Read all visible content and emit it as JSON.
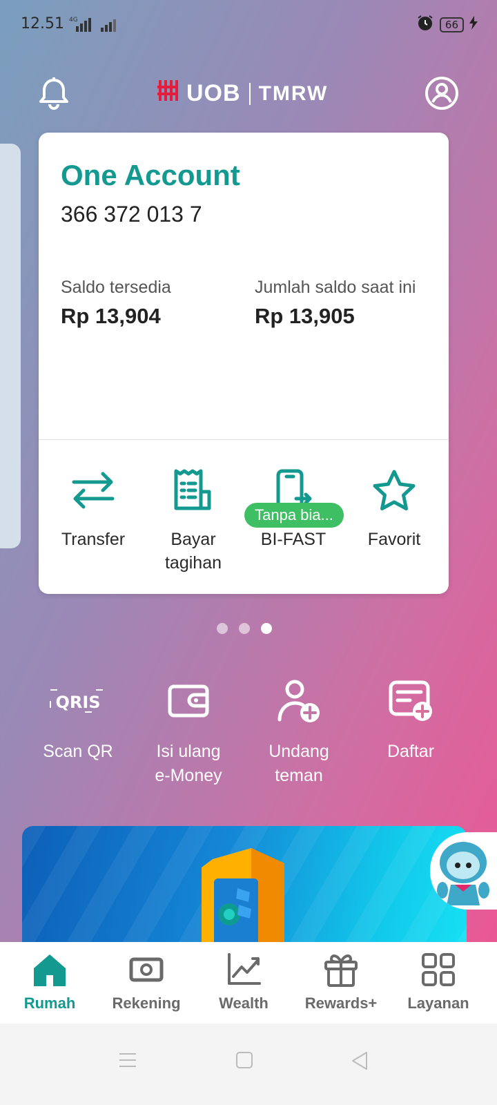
{
  "status": {
    "time": "12.51",
    "network": "4G",
    "battery": "66"
  },
  "header": {
    "brand": "UOB",
    "product": "TMRW",
    "bell_icon": "bell-icon",
    "profile_icon": "profile-icon"
  },
  "account_card": {
    "title": "One Account",
    "number": "366 372 013 7",
    "available_label": "Saldo tersedia",
    "available_value": "Rp 13,904",
    "current_label": "Jumlah saldo saat ini",
    "current_value": "Rp 13,905",
    "actions": [
      {
        "label": "Transfer",
        "icon": "transfer-icon"
      },
      {
        "label": "Bayar\ntagihan",
        "icon": "bill-icon"
      },
      {
        "label": "BI-FAST",
        "icon": "bifast-icon"
      },
      {
        "label": "Favorit",
        "icon": "star-icon"
      }
    ],
    "bifast_badge": "Tanpa bia..."
  },
  "pager": {
    "count": 3,
    "active": 3
  },
  "quick_actions": [
    {
      "label": "Scan QR",
      "icon": "qris-icon",
      "logo_text": "QRIS"
    },
    {
      "label": "Isi ulang\ne-Money",
      "icon": "wallet-icon"
    },
    {
      "label": "Undang\nteman",
      "icon": "add-user-icon"
    },
    {
      "label": "Daftar",
      "icon": "add-form-icon"
    }
  ],
  "bottom_nav": [
    {
      "label": "Rumah",
      "icon": "home-icon",
      "active": true
    },
    {
      "label": "Rekening",
      "icon": "money-icon",
      "active": false
    },
    {
      "label": "Wealth",
      "icon": "chart-icon",
      "active": false
    },
    {
      "label": "Rewards+",
      "icon": "gift-icon",
      "active": false
    },
    {
      "label": "Layanan",
      "icon": "grid-icon",
      "active": false
    }
  ],
  "colors": {
    "accent": "#13998f",
    "badge": "#3fbf63",
    "brand_red": "#e31d3b"
  }
}
